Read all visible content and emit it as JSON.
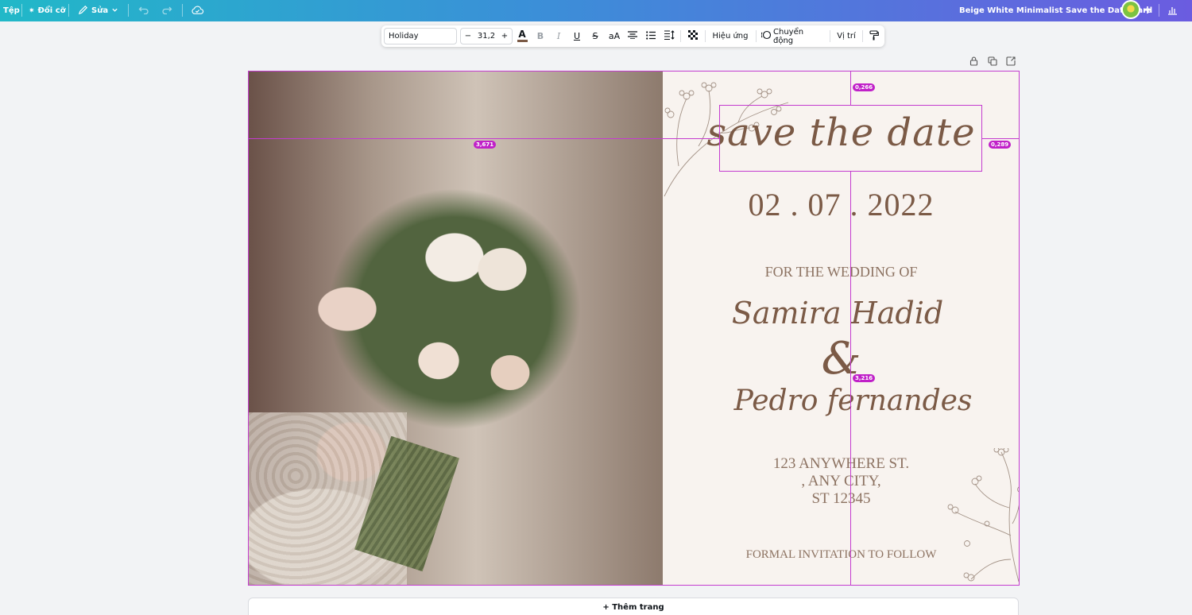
{
  "topbar": {
    "file_label": "Tệp",
    "resize_label": "Đổi cỡ",
    "edit_label": "Sửa",
    "doc_title": "Beige White Minimalist Save the Date Card",
    "plus_label": "+"
  },
  "toolbar": {
    "font_name": "Holiday",
    "minus_label": "−",
    "font_size": "31,2",
    "plus_label": "+",
    "text_color_label": "A",
    "bold_label": "B",
    "italic_label": "I",
    "underline_label": "U",
    "strike_label": "S",
    "case_label": "aA",
    "effects_label": "Hiệu ứng",
    "animate_label": "Chuyển động",
    "position_label": "Vị trí"
  },
  "card": {
    "save_the_date": "save the date",
    "date": "02 . 07 . 2022",
    "for_wedding": "FOR THE WEDDING OF",
    "name1": "Samira Hadid",
    "ampersand": "&",
    "name2": "Pedro fernandes",
    "address_line1": "123 ANYWHERE ST.",
    "address_line2": ", ANY CITY,",
    "address_line3": "ST 12345",
    "formal": "FORMAL INVITATION TO FOLLOW"
  },
  "guides": {
    "badge_top": "0,266",
    "badge_left": "3,671",
    "badge_right": "0,289",
    "badge_bottom": "3,216"
  },
  "add_page_label": "+ Thêm trang",
  "colors": {
    "accent_guide": "#c43ccf",
    "card_bg": "#f8f3ef",
    "text_brown": "#7b5a46"
  }
}
